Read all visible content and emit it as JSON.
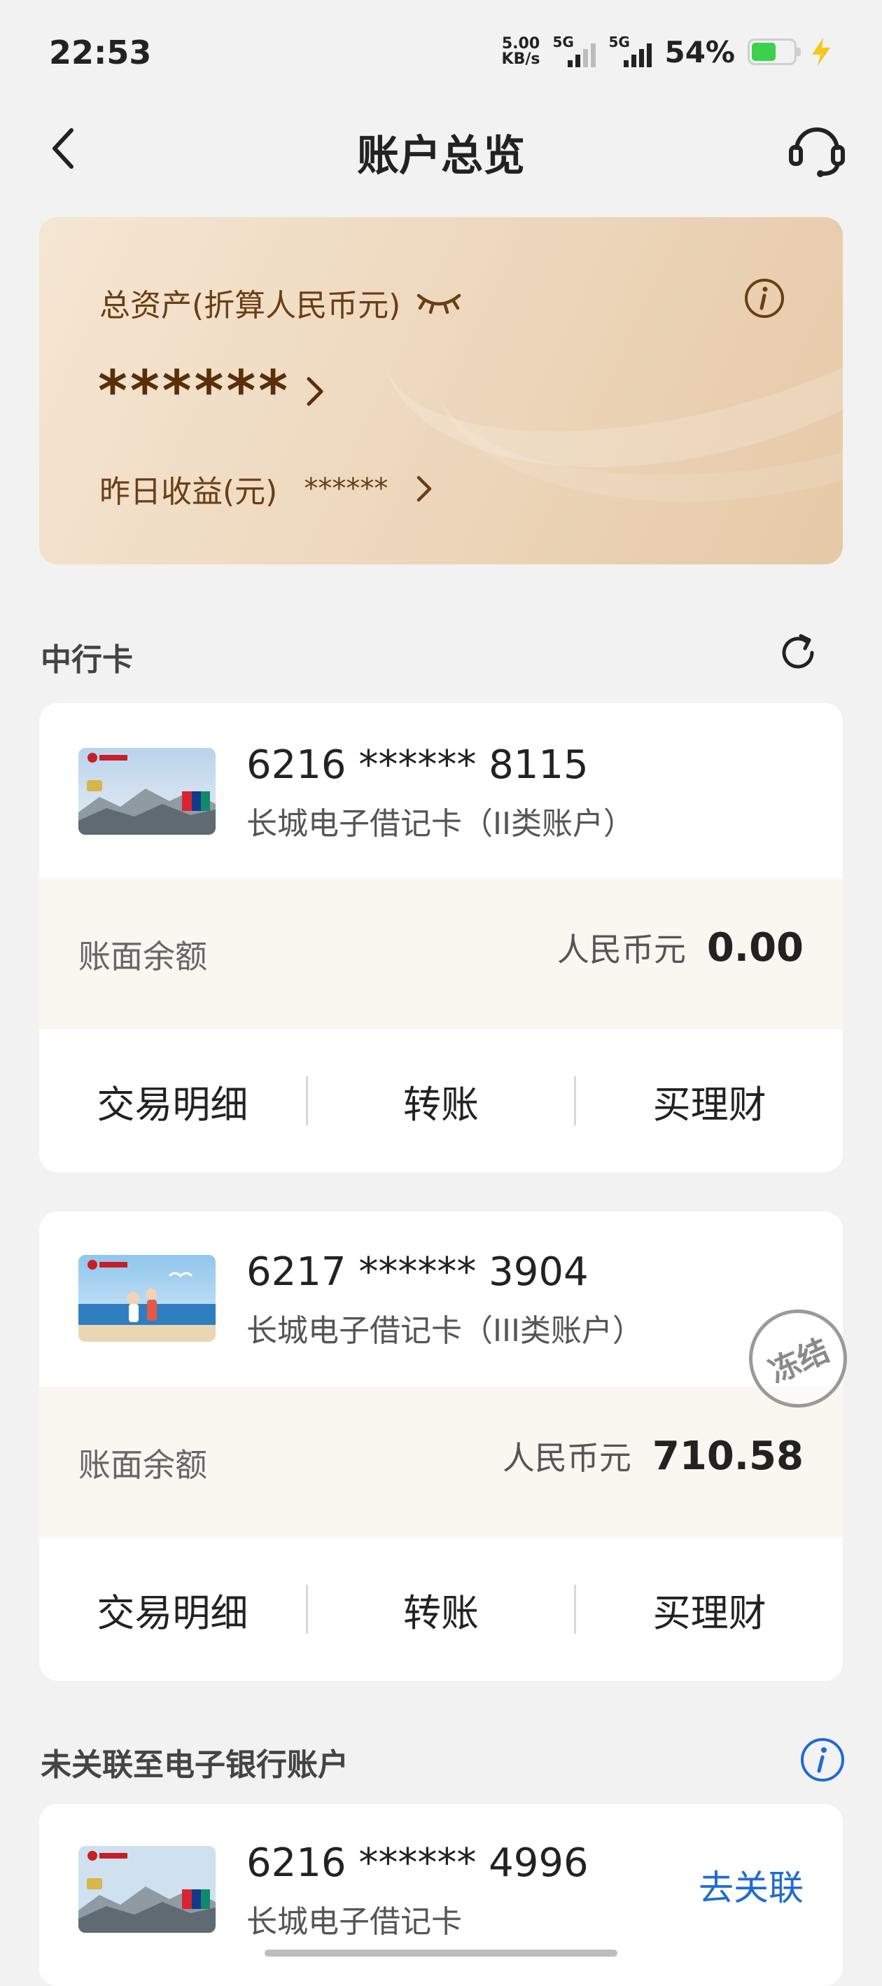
{
  "status_bar": {
    "time": "22:53",
    "net_speed_value": "5.00",
    "net_speed_unit": "KB/s",
    "sim1_label": "5G",
    "sim2_label": "5G",
    "battery_percent": "54%"
  },
  "nav": {
    "title": "账户总览"
  },
  "asset_card": {
    "total_label": "总资产(折算人民币元)",
    "total_value": "******",
    "yesterday_label": "昨日收益(元)",
    "yesterday_value": "******"
  },
  "section_boc": {
    "title": "中行卡"
  },
  "accounts": [
    {
      "number": "6216 ****** 8115",
      "type": "长城电子借记卡（II类账户）",
      "balance_label": "账面余额",
      "currency": "人民币元",
      "balance": "0.00",
      "actions": [
        "交易明细",
        "转账",
        "买理财"
      ]
    },
    {
      "number": "6217 ****** 3904",
      "type": "长城电子借记卡（III类账户）",
      "stamp": "冻结",
      "balance_label": "账面余额",
      "currency": "人民币元",
      "balance": "710.58",
      "actions": [
        "交易明细",
        "转账",
        "买理财"
      ]
    }
  ],
  "section_unlinked": {
    "title": "未关联至电子银行账户"
  },
  "unlinked_account": {
    "number": "6216 ****** 4996",
    "type": "长城电子借记卡",
    "link_label": "去关联"
  },
  "icons": {
    "back": "chevron-left-icon",
    "customer_service": "headset-icon",
    "eye_closed": "eye-closed-icon",
    "info": "info-icon",
    "refresh": "refresh-icon"
  },
  "colors": {
    "asset_text": "#6b3e12",
    "link_blue": "#1f6bd2",
    "balance_bg": "#faf6f0",
    "battery_green": "#3bd14c"
  }
}
